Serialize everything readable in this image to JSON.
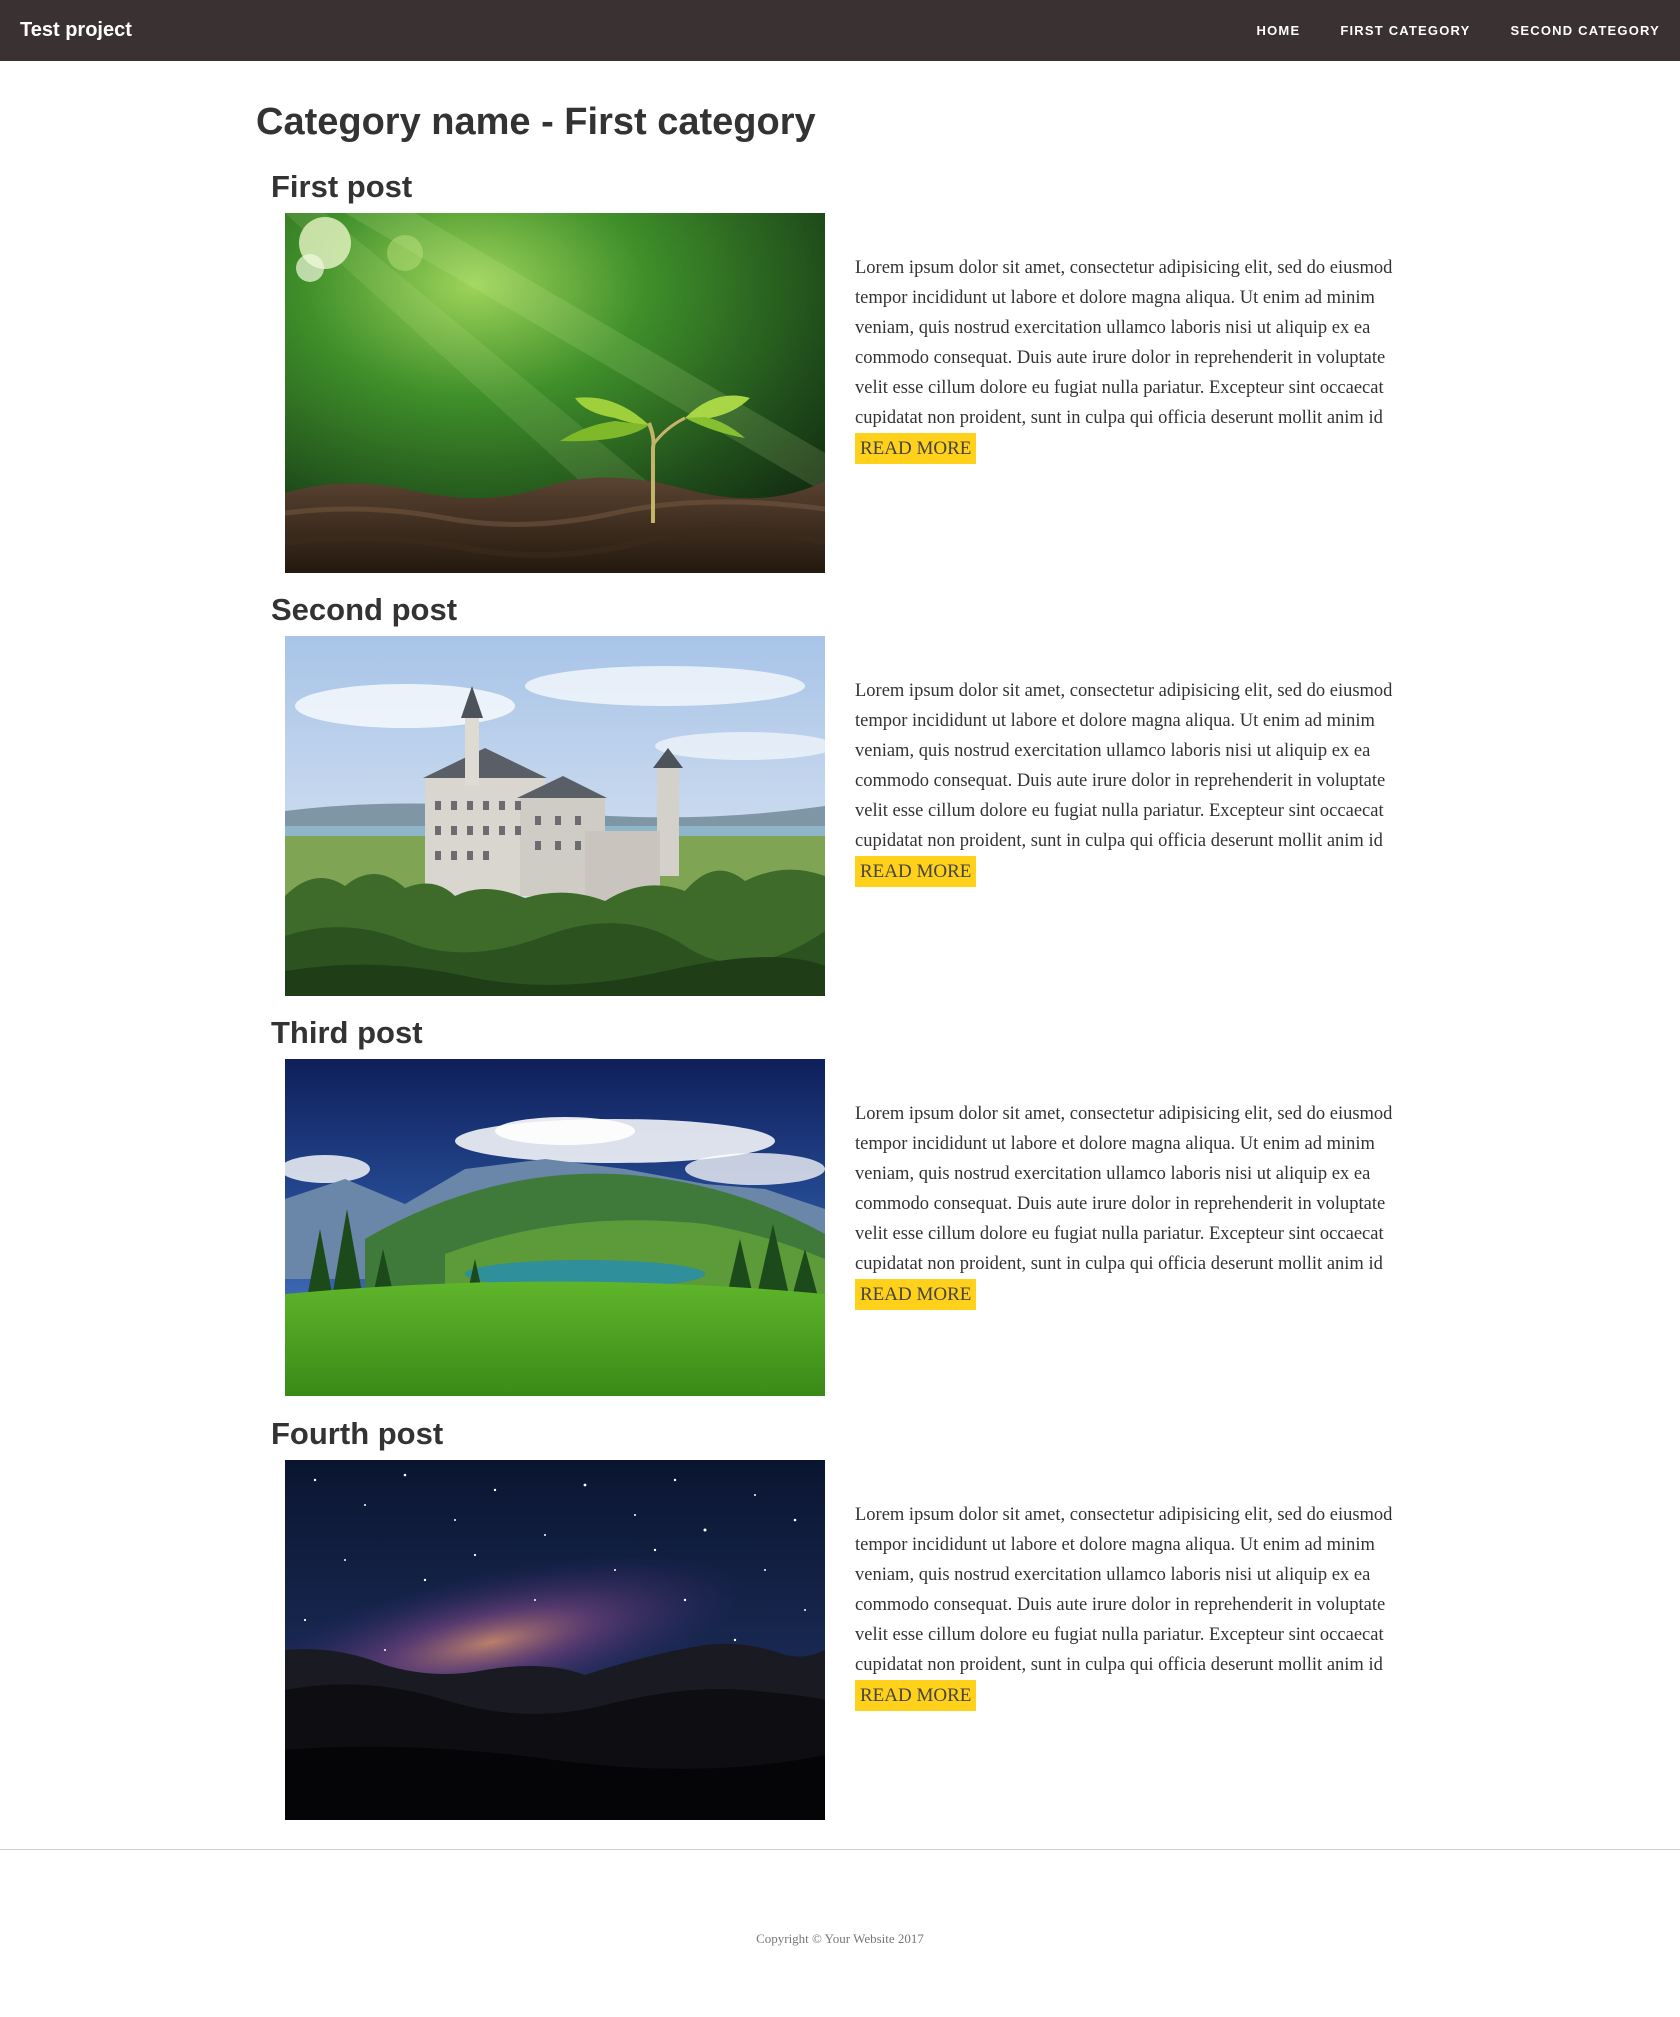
{
  "navbar": {
    "brand": "Test project",
    "items": [
      {
        "label": "HOME"
      },
      {
        "label": "FIRST CATEGORY"
      },
      {
        "label": "SECOND CATEGORY"
      }
    ]
  },
  "page": {
    "title": "Category name - First category"
  },
  "posts": [
    {
      "title": "First post",
      "image": "seedling-photo",
      "text": "Lorem ipsum dolor sit amet, consectetur adipisicing elit, sed do eiusmod tempor incididunt ut labore et dolore magna aliqua. Ut enim ad minim veniam, quis nostrud exercitation ullamco laboris nisi ut aliquip ex ea commodo consequat. Duis aute irure dolor in reprehenderit in voluptate velit esse cillum dolore eu fugiat nulla pariatur. Excepteur sint occaecat cupidatat non proident, sunt in culpa qui officia deserunt mollit anim id est laborum.",
      "read_more": "READ MORE"
    },
    {
      "title": "Second post",
      "image": "castle-photo",
      "text": "Lorem ipsum dolor sit amet, consectetur adipisicing elit, sed do eiusmod tempor incididunt ut labore et dolore magna aliqua. Ut enim ad minim veniam, quis nostrud exercitation ullamco laboris nisi ut aliquip ex ea commodo consequat. Duis aute irure dolor in reprehenderit in voluptate velit esse cillum dolore eu fugiat nulla pariatur. Excepteur sint occaecat cupidatat non proident, sunt in culpa qui officia deserunt mollit anim id est laborum.",
      "read_more": "READ MORE"
    },
    {
      "title": "Third post",
      "image": "mountain-lake-photo",
      "text": "Lorem ipsum dolor sit amet, consectetur adipisicing elit, sed do eiusmod tempor incididunt ut labore et dolore magna aliqua. Ut enim ad minim veniam, quis nostrud exercitation ullamco laboris nisi ut aliquip ex ea commodo consequat. Duis aute irure dolor in reprehenderit in voluptate velit esse cillum dolore eu fugiat nulla pariatur. Excepteur sint occaecat cupidatat non proident, sunt in culpa qui officia deserunt mollit anim id est laborum.",
      "read_more": "READ MORE"
    },
    {
      "title": "Fourth post",
      "image": "night-sky-photo",
      "text": "Lorem ipsum dolor sit amet, consectetur adipisicing elit, sed do eiusmod tempor incididunt ut labore et dolore magna aliqua. Ut enim ad minim veniam, quis nostrud exercitation ullamco laboris nisi ut aliquip ex ea commodo consequat. Duis aute irure dolor in reprehenderit in voluptate velit esse cillum dolore eu fugiat nulla pariatur. Excepteur sint occaecat cupidatat non proident, sunt in culpa qui officia deserunt mollit anim id est laborum.",
      "read_more": "READ MORE"
    }
  ],
  "footer": {
    "copyright": "Copyright © Your Website 2017"
  },
  "colors": {
    "navbar_bg": "#393132",
    "button_bg": "#ffd11a",
    "text": "#333333"
  }
}
